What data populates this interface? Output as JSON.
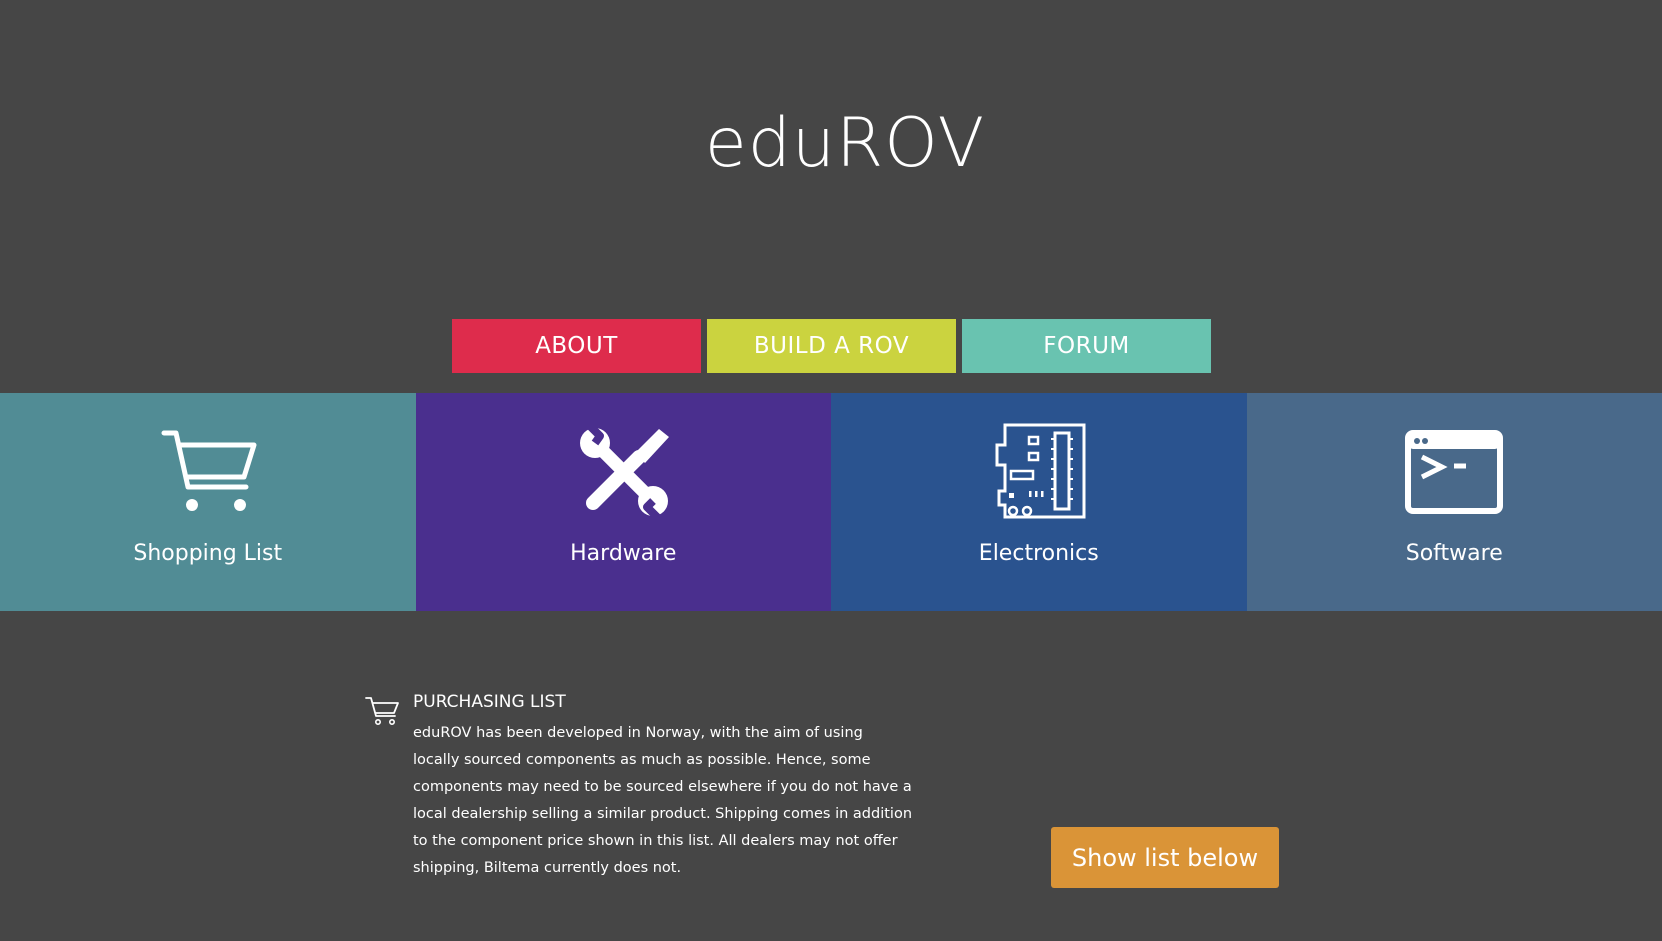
{
  "header": {
    "title": "eduROV"
  },
  "nav": {
    "about": "ABOUT",
    "build": "BUILD A ROV",
    "forum": "FORUM"
  },
  "tiles": [
    {
      "label": "Shopping List",
      "icon": "shopping-cart-icon",
      "color": "#518c95"
    },
    {
      "label": "Hardware",
      "icon": "wrench-screwdriver-icon",
      "color": "#4a2f8e"
    },
    {
      "label": "Electronics",
      "icon": "circuit-board-icon",
      "color": "#2a538f"
    },
    {
      "label": "Software",
      "icon": "terminal-icon",
      "color": "#49698a"
    }
  ],
  "purchasing": {
    "icon": "shopping-cart-icon",
    "title": "PURCHASING LIST",
    "body": "eduROV has been developed in Norway, with the aim of using locally sourced components as much as possible. Hence, some components may need to be sourced elsewhere if you do not have a local dealership selling a similar product. Shipping comes in addition to the component price shown in this list. All dealers may not offer shipping, Biltema currently does not."
  },
  "actions": {
    "show_list": "Show list below"
  },
  "colors": {
    "background": "#464646",
    "about": "#de2c4c",
    "build": "#cbd33f",
    "forum": "#69c3b0",
    "button": "#da9437"
  }
}
